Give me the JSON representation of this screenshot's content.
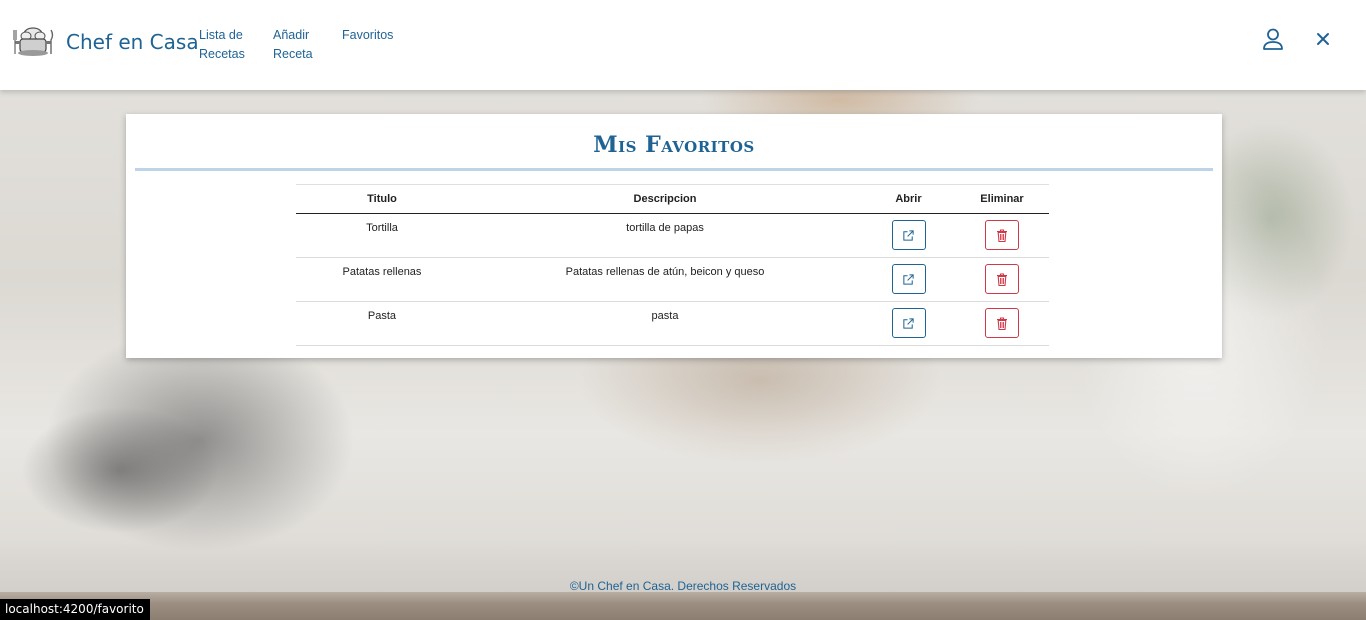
{
  "brand": {
    "name": "Chef en Casa",
    "logo": "chef-hat-pot-logo"
  },
  "nav": {
    "items": [
      {
        "label": "Lista de\nRecetas"
      },
      {
        "label": "Añadir\nReceta"
      },
      {
        "label": "Favoritos"
      }
    ],
    "user_icon": "user-icon",
    "close_icon": "close-icon"
  },
  "favorites": {
    "title": "Mis Favoritos",
    "columns": [
      "Titulo",
      "Descripcion",
      "Abrir",
      "Eliminar"
    ],
    "rows": [
      {
        "titulo": "Tortilla",
        "descripcion": "tortilla de papas"
      },
      {
        "titulo": "Patatas rellenas",
        "descripcion": "Patatas rellenas de atún, beicon y queso"
      },
      {
        "titulo": "Pasta",
        "descripcion": "pasta"
      }
    ],
    "open_icon": "external-link-icon",
    "delete_icon": "trash-icon"
  },
  "footer": {
    "text": "©Un Chef en Casa. Derechos Reservados"
  },
  "status_bar": {
    "url": "localhost:4200/favorito"
  },
  "colors": {
    "primary": "#1f6394",
    "danger": "#d03a48",
    "title_rule": "#bcd3e8"
  }
}
